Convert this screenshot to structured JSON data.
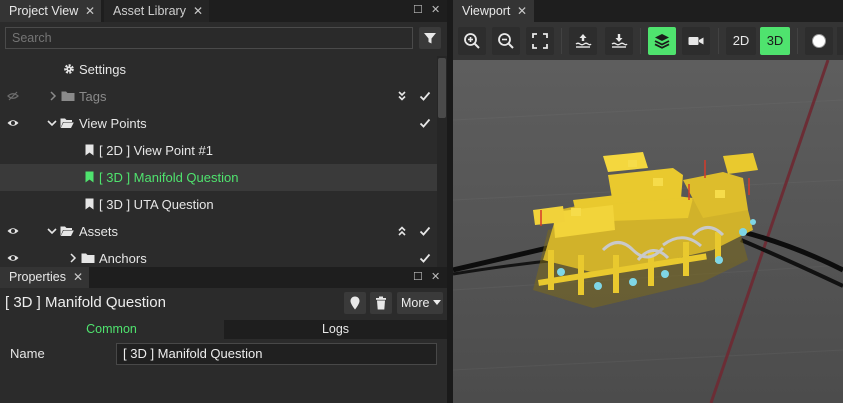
{
  "left_tabs": [
    {
      "label": "Project View",
      "active": true
    },
    {
      "label": "Asset Library",
      "active": false
    }
  ],
  "search": {
    "placeholder": "Search"
  },
  "tree": [
    {
      "label": "Settings",
      "icon": "gear-icon"
    },
    {
      "label": "Tags",
      "icon": "folder-icon",
      "expanded": false,
      "hidden": true
    },
    {
      "label": "View Points",
      "icon": "folder-open-icon",
      "expanded": true
    },
    {
      "label": "[ 2D ] View Point #1",
      "icon": "bookmark-icon"
    },
    {
      "label": "[ 3D ] Manifold Question",
      "icon": "bookmark-icon",
      "selected": true
    },
    {
      "label": "[ 3D ] UTA Question",
      "icon": "bookmark-icon"
    },
    {
      "label": "Assets",
      "icon": "folder-open-icon",
      "expanded": true
    },
    {
      "label": "Anchors",
      "icon": "folder-icon",
      "expanded": false
    }
  ],
  "properties": {
    "tab_label": "Properties",
    "title": "[ 3D ] Manifold Question",
    "more_label": "More",
    "subtabs": [
      {
        "label": "Common",
        "active": true
      },
      {
        "label": "Logs",
        "active": false
      }
    ],
    "name_label": "Name",
    "name_value": "[ 3D ] Manifold Question"
  },
  "viewport": {
    "tab_label": "Viewport",
    "toolbar": {
      "mode_2d": "2D",
      "mode_3d": "3D",
      "active_mode": "3D"
    }
  },
  "colors": {
    "accent": "#4fe36e",
    "selected_text": "#4fe36e",
    "manifold": "#e9c92e",
    "scene_bg": "#585858"
  }
}
